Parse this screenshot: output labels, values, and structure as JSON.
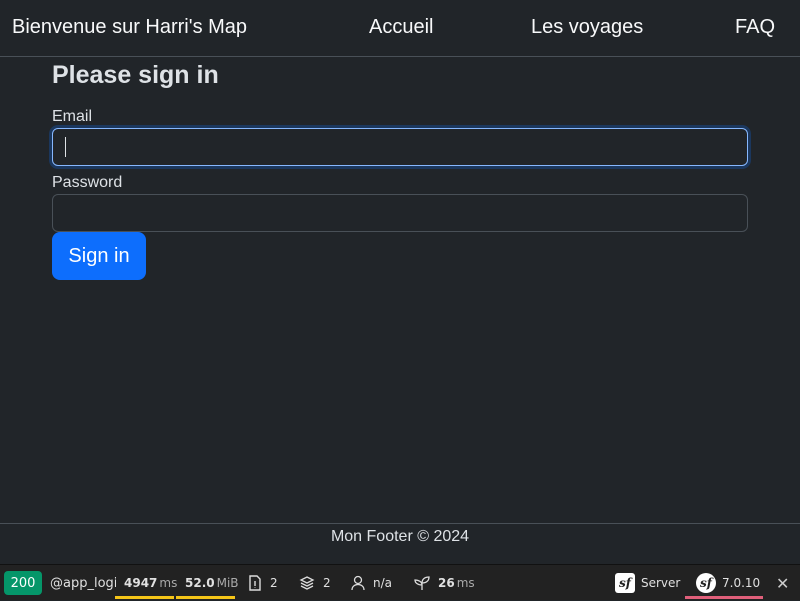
{
  "navbar": {
    "brand": "Bienvenue sur Harri's Map",
    "links": [
      "Accueil",
      "Les voyages",
      "FAQ"
    ]
  },
  "form": {
    "title": "Please sign in",
    "email_label": "Email",
    "email_value": "",
    "password_label": "Password",
    "password_value": "",
    "submit_label": "Sign in"
  },
  "footer": {
    "text": "Mon Footer © 2024"
  },
  "debug_toolbar": {
    "status_code": "200",
    "route": "@app_login",
    "time_value": "4947",
    "time_unit": "ms",
    "memory_value": "52.0",
    "memory_unit": "MiB",
    "logs_count": "2",
    "db_count": "2",
    "user": "n/a",
    "mailer_value": "26",
    "mailer_unit": "ms",
    "server_label": "Server",
    "version": "7.0.10"
  },
  "colors": {
    "background": "#212529",
    "primary": "#0d6efd",
    "status_ok": "#059669",
    "toolbar_warning": "#f5c518",
    "toolbar_version": "#e05f7a"
  }
}
